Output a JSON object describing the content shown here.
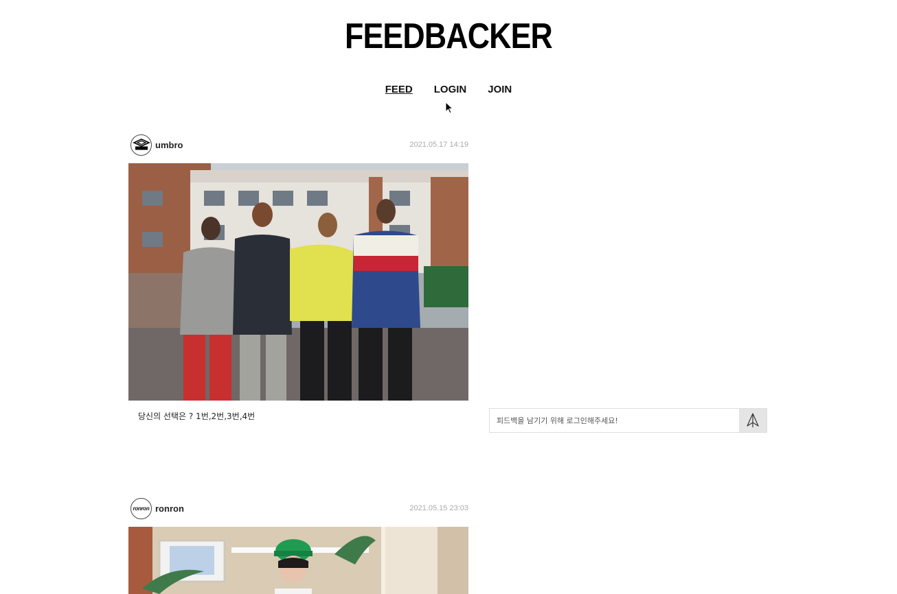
{
  "app": {
    "logo": "FEEDBACKER"
  },
  "nav": {
    "items": [
      {
        "label": "FEED"
      },
      {
        "label": "LOGIN"
      },
      {
        "label": "JOIN"
      }
    ]
  },
  "posts": [
    {
      "username": "umbro",
      "avatar_text": "umbro",
      "date": "2021.05.17 14:19",
      "caption": "당신의 선택은 ? 1번,2번,3번,4번"
    },
    {
      "username": "ronron",
      "avatar_text": "ronron",
      "date": "2021.05.15 23:03"
    }
  ],
  "feedback": {
    "placeholder": "피드백을 남기기 위해 로그인해주세요!"
  },
  "icons": {
    "cursor": "arrow-cursor-icon",
    "send": "paper-plane-icon",
    "umbro_logo": "umbro-diamond-icon"
  }
}
